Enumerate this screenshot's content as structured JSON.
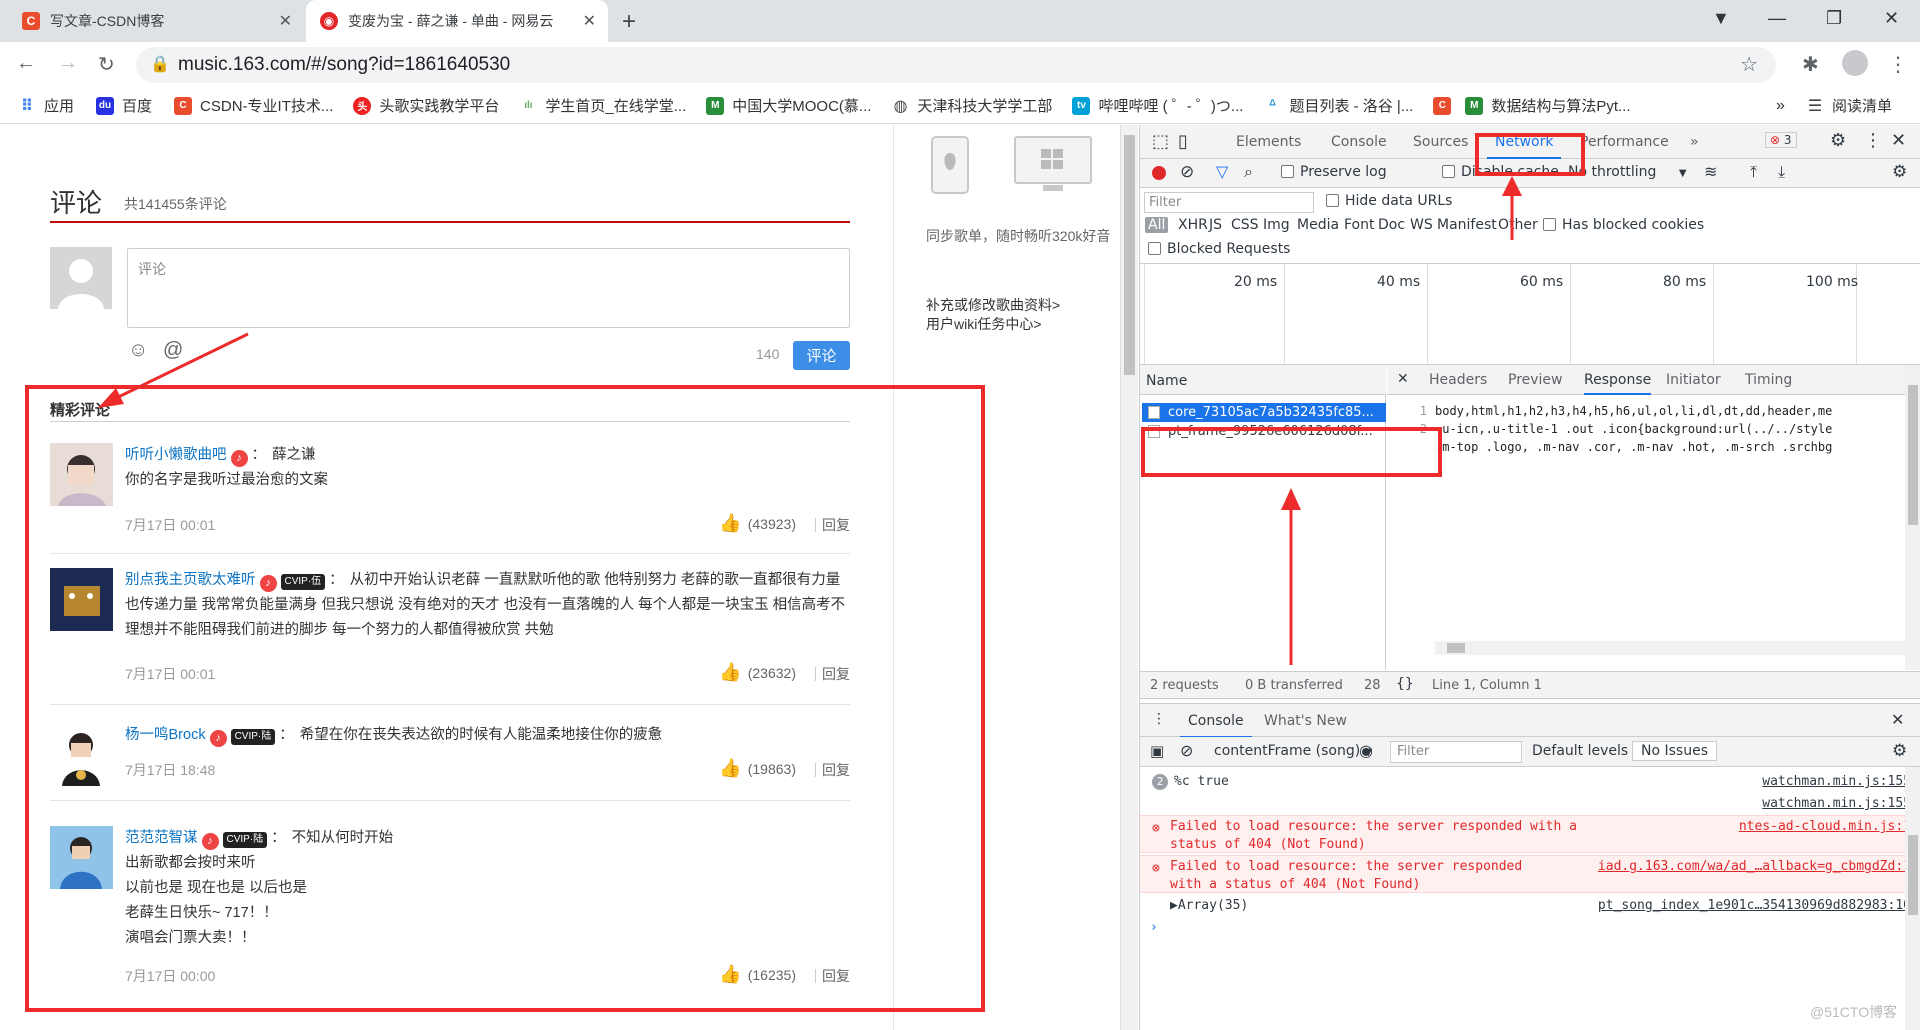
{
  "browser": {
    "tabs": [
      {
        "title": "写文章-CSDN博客",
        "favicon": "C",
        "color": "#e94d2e"
      },
      {
        "title": "变废为宝 - 薛之谦 - 单曲 - 网易云",
        "favicon": "◉",
        "color": "#e3262a"
      }
    ],
    "url": "music.163.com/#/song?id=1861640530",
    "bookmarks": [
      {
        "label": "应用",
        "icon": "apps-icon",
        "color": "#4285f4"
      },
      {
        "label": "百度",
        "icon": "baidu-icon",
        "color": "#2932e1"
      },
      {
        "label": "CSDN-专业IT技术...",
        "icon": "csdn-icon",
        "color": "#e94d2e"
      },
      {
        "label": "头歌实践教学平台",
        "icon": "toutiao-icon",
        "color": "#e22"
      },
      {
        "label": "学生首页_在线学堂...",
        "icon": "xuetang-icon",
        "color": "#6a6"
      },
      {
        "label": "中国大学MOOC(慕...",
        "icon": "mooc-icon",
        "color": "#2a8d3a"
      },
      {
        "label": "天津科技大学学工部",
        "icon": "globe-icon",
        "color": "#444"
      },
      {
        "label": "哔哩哔哩 ( ゜- ゜)つ...",
        "icon": "bilibili-icon",
        "color": "#00a1d6"
      },
      {
        "label": "题目列表 - 洛谷 |...",
        "icon": "luogu-icon",
        "color": "#3498db"
      },
      {
        "label": "",
        "icon": "csdn-icon",
        "color": "#e94d2e"
      },
      {
        "label": "数据结构与算法Pyt...",
        "icon": "mooc-icon",
        "color": "#2a8d3a"
      }
    ],
    "reading_list": "阅读清单",
    "more": "»"
  },
  "page": {
    "section_title": "评论",
    "section_count": "共141455条评论",
    "comment_placeholder": "评论",
    "char_count": "140",
    "submit_label": "评论",
    "hot_title": "精彩评论",
    "side_text_1": "同步歌单，随时畅听320k好音",
    "side_link_1": "补充或修改歌曲资料>",
    "side_link_2": "用户wiki任务中心>",
    "comments": [
      {
        "user": "听听小懒歌曲吧",
        "vip": "",
        "reply_to": "薛之谦",
        "text": "你的名字是我听过最治愈的文案",
        "time": "7月17日 00:01",
        "likes": "(43923)",
        "reply": "回复"
      },
      {
        "user": "别点我主页歌太难听",
        "vip": "CVIP·伍",
        "reply_to": "",
        "text": "从初中开始认识老薛 一直默默听他的歌 他特别努力 老薛的歌一直都很有力量 也传递力量 我常常负能量满身 但我只想说 没有绝对的天才 也没有一直落魄的人 每个人都是一块宝玉 相信高考不理想并不能阻碍我们前进的脚步 每一个努力的人都值得被欣赏 共勉",
        "time": "7月17日 00:01",
        "likes": "(23632)",
        "reply": "回复"
      },
      {
        "user": "杨一鸣Brock",
        "vip": "CVIP·陆",
        "reply_to": "",
        "text": "希望在你在丧失表达欲的时候有人能温柔地接住你的疲惫",
        "time": "7月17日 18:48",
        "likes": "(19863)",
        "reply": "回复"
      },
      {
        "user": "范范范智谋",
        "vip": "CVIP·陆",
        "reply_to": "",
        "text": "不知从何时开始",
        "extra_lines": [
          "出新歌都会按时来听",
          "以前也是 现在也是 以后也是",
          "老薛生日快乐~ 717！！",
          "演唱会门票大卖！！"
        ],
        "time": "7月17日 00:00",
        "likes": "(16235)",
        "reply": "回复"
      }
    ]
  },
  "devtools": {
    "tabs": [
      "Elements",
      "Console",
      "Sources",
      "Network",
      "Performance"
    ],
    "more_tabs": "»",
    "error_count": "3",
    "network": {
      "preserve_log": "Preserve log",
      "disable_cache": "Disable cache",
      "throttling": "No throttling",
      "filter_placeholder": "Filter",
      "hide_data_urls": "Hide data URLs",
      "types": [
        "All",
        "XHR",
        "JS",
        "CSS",
        "Img",
        "Media",
        "Font",
        "Doc",
        "WS",
        "Manifest",
        "Other"
      ],
      "has_blocked_cookies": "Has blocked cookies",
      "blocked_requests": "Blocked Requests",
      "timeline": [
        "20 ms",
        "40 ms",
        "60 ms",
        "80 ms",
        "100 ms"
      ],
      "name_header": "Name",
      "requests": [
        "core_73105ac7a5b32435fc85...",
        "pt_frame_99526e606126d08f..."
      ],
      "detail_tabs": [
        "Headers",
        "Preview",
        "Response",
        "Initiator",
        "Timing"
      ],
      "response_lines": [
        {
          "num": "1",
          "code": "body,html,h1,h2,h3,h4,h5,h6,ul,ol,li,dl,dt,dd,header,me"
        },
        {
          "num": "2",
          "code": ".u-icn,.u-title-1 .out .icon{background:url(../../style"
        },
        {
          "num": "",
          "code": ".m-top .logo, .m-nav .cor, .m-nav .hot, .m-srch .srchbg"
        }
      ],
      "status_requests": "2 requests",
      "status_transferred": "0 B transferred",
      "status_more": "28",
      "status_position": "Line 1, Column 1"
    },
    "drawer": {
      "tabs": [
        "Console",
        "What's New"
      ],
      "context": "contentFrame (song)",
      "filter_placeholder": "Filter",
      "levels": "Default levels",
      "issues": "No Issues",
      "messages": [
        {
          "type": "log",
          "count": "2",
          "text": "%c true",
          "src": "watchman.min.js:155"
        },
        {
          "type": "log",
          "count": "",
          "text": "",
          "src": "watchman.min.js:155"
        },
        {
          "type": "error",
          "count": "",
          "text": "Failed to load resource: the server responded with a status of 404 (Not Found)",
          "src": "ntes-ad-cloud.min.js:1"
        },
        {
          "type": "error",
          "count": "",
          "text": "Failed to load resource: the server responded with a status of 404 (Not Found)",
          "src": "iad.g.163.com/wa/ad_…allback=g_cbmgdZd:1"
        },
        {
          "type": "log",
          "count": "",
          "text": "▶Array(35)",
          "src": "pt_song_index_1e901c…354130969d882983:10"
        }
      ]
    }
  },
  "watermark": "@51CTO博客"
}
